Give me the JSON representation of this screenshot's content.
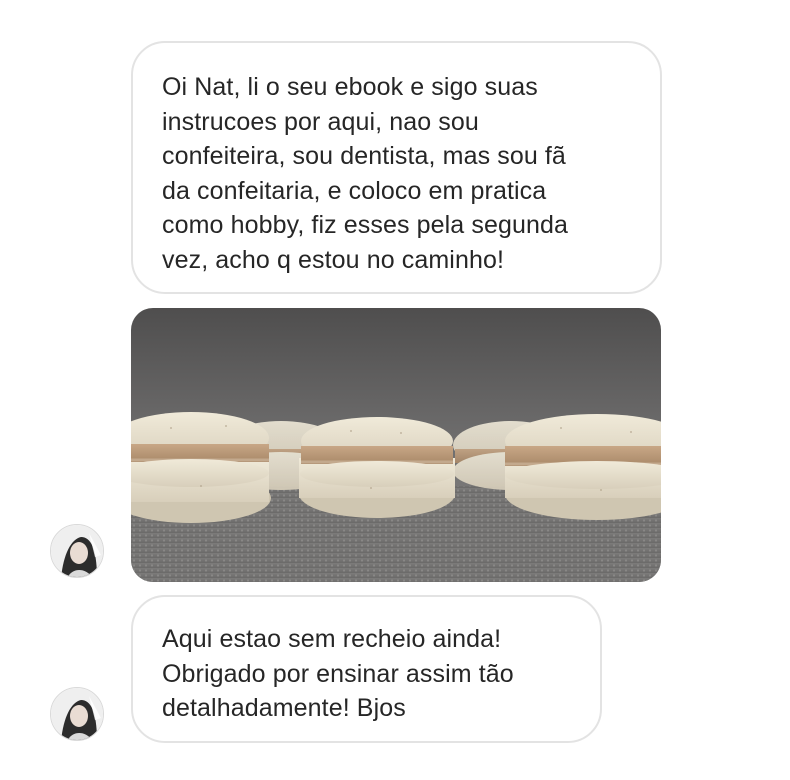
{
  "thread": {
    "messages": [
      {
        "type": "text",
        "lines": [
          "Oi Nat, li o seu ebook e sigo suas",
          "instrucoes por aqui, nao sou",
          "confeiteira, sou dentista, mas sou fã",
          "da confeitaria, e coloco em pratica",
          "como hobby, fiz esses pela segunda",
          "vez, acho q estou no caminho!"
        ]
      },
      {
        "type": "image",
        "subject": "macarons-photo"
      },
      {
        "type": "text",
        "lines": [
          "Aqui estao sem recheio ainda!",
          "Obrigado por ensinar assim tão",
          "detalhadamente! Bjos"
        ]
      }
    ]
  },
  "colors": {
    "bubble_border": "#e3e3e3",
    "text": "#262626",
    "background": "#ffffff"
  }
}
